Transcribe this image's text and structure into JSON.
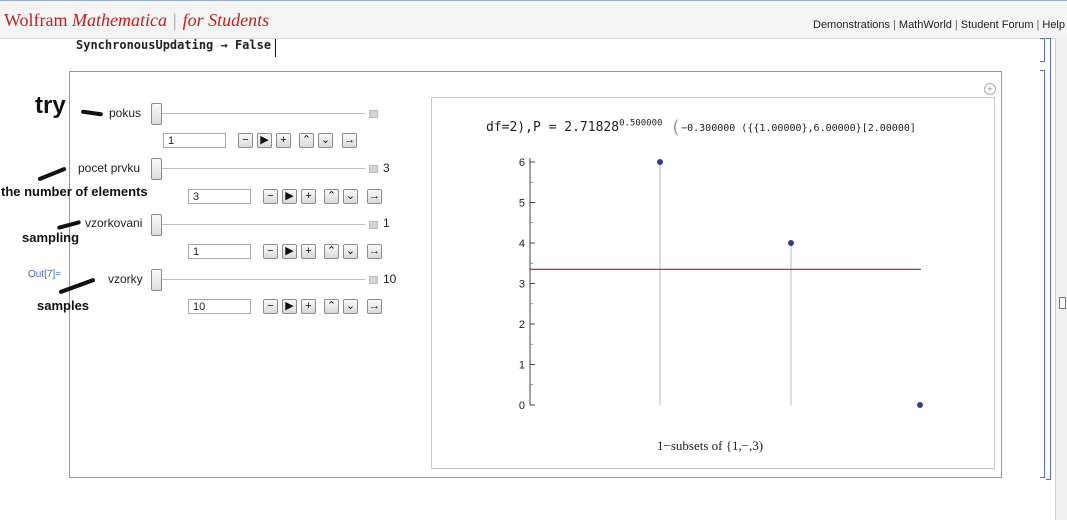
{
  "header": {
    "brand_wolfram": "Wolfram",
    "brand_mathematica": "Mathematica",
    "brand_for_students": "for Students",
    "links": [
      "Demonstrations",
      "MathWorld",
      "Student Forum",
      "Help"
    ]
  },
  "notebook": {
    "code_line": "SynchronousUpdating → False",
    "out_label": "Out[7]="
  },
  "controls": [
    {
      "label": "pokus",
      "value_display": "",
      "input_value": "1"
    },
    {
      "label": "pocet prvku",
      "value_display": "3",
      "input_value": "3"
    },
    {
      "label": "vzorkovani",
      "value_display": "1",
      "input_value": "1"
    },
    {
      "label": "vzorky",
      "value_display": "10",
      "input_value": "10"
    }
  ],
  "anim_buttons": [
    "minus",
    "play",
    "plus",
    "faster",
    "slower",
    "direction"
  ],
  "annotations": [
    "try",
    "the number of elements",
    "sampling",
    "samples"
  ],
  "plot": {
    "title_main": "df=2),P = 2.71828",
    "title_exponent": "0.500000",
    "title_tail": "−0.300000 ({{1.00000},6.00000}[2.00000]",
    "xlabel": "1−subsets of {1,−,3)",
    "colors": {
      "points": "#3a3a8c",
      "stems": "#d0d0dc",
      "hline": "#8b2252"
    }
  },
  "chart_data": {
    "type": "scatter",
    "xlabel": "1−subsets of {1,−,3)",
    "yticks": [
      0,
      1,
      2,
      3,
      4,
      5,
      6
    ],
    "ylim": [
      0,
      6
    ],
    "points": [
      {
        "x": 1,
        "y": 6
      },
      {
        "x": 2,
        "y": 4
      },
      {
        "x": 3,
        "y": 0
      }
    ],
    "hline_y": 3.35
  }
}
